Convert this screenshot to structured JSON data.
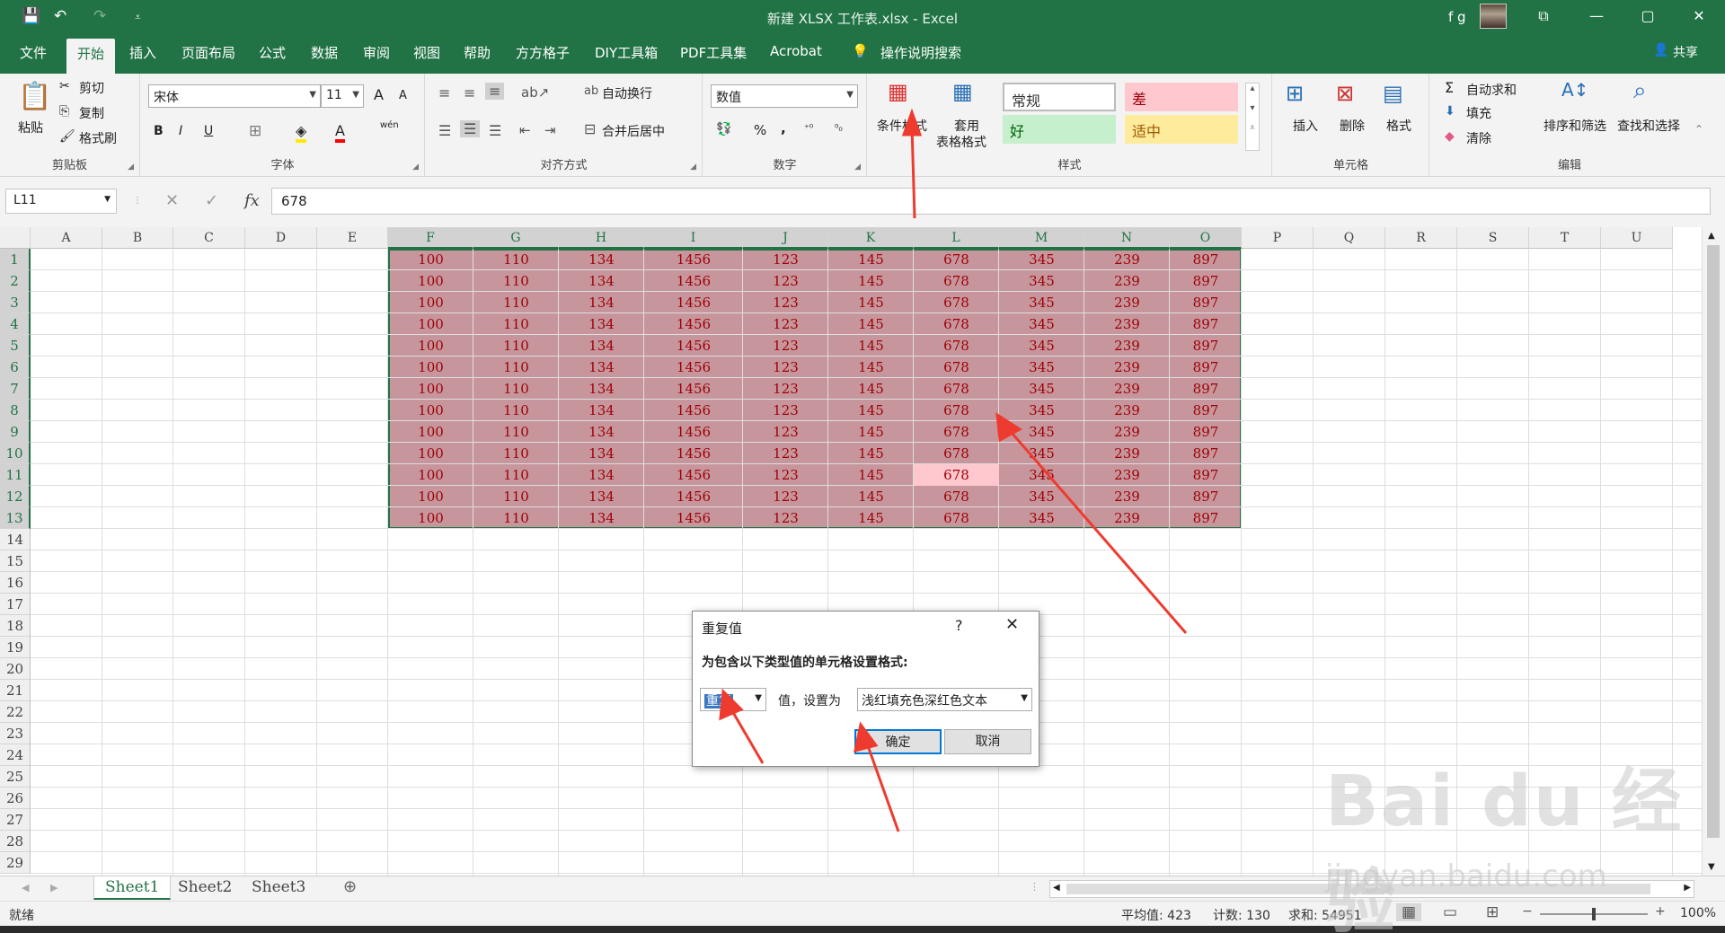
{
  "window": {
    "title": "新建 XLSX 工作表.xlsx  -  Excel",
    "user": "f g",
    "restore_icon": "⧉",
    "minimize": "—",
    "maximize": "▢",
    "close": "✕"
  },
  "quick_access": {
    "save": "💾",
    "undo": "↶",
    "redo": "↷",
    "customize": "⩡"
  },
  "tabs": [
    "文件",
    "开始",
    "插入",
    "页面布局",
    "公式",
    "数据",
    "审阅",
    "视图",
    "帮助",
    "方方格子",
    "DIY工具箱",
    "PDF工具集",
    "Acrobat"
  ],
  "active_tab": "开始",
  "tell_me": "操作说明搜索",
  "share": "共享",
  "ribbon": {
    "clipboard": {
      "paste": "粘贴",
      "cut": "剪切",
      "copy": "复制",
      "format_painter": "格式刷",
      "label": "剪贴板"
    },
    "font": {
      "name": "宋体",
      "size": "11",
      "grow": "A",
      "shrink": "A",
      "bold": "B",
      "italic": "I",
      "underline": "U",
      "label": "字体",
      "wen": "wén"
    },
    "alignment": {
      "wrap": "自动换行",
      "merge": "合并后居中",
      "label": "对齐方式"
    },
    "number": {
      "format": "数值",
      "percent": "%",
      "comma": ",",
      "label": "数字"
    },
    "styles": {
      "cond_format": "条件格式",
      "table_format_1": "套用",
      "table_format_2": "表格格式",
      "normal": "常规",
      "bad": "差",
      "good": "好",
      "neutral": "适中",
      "label": "样式"
    },
    "cells": {
      "insert": "插入",
      "delete": "删除",
      "format": "格式",
      "label": "单元格"
    },
    "editing": {
      "autosum": "自动求和",
      "fill": "填充",
      "clear": "清除",
      "sort": "排序和筛选",
      "find": "查找和选择",
      "label": "编辑"
    }
  },
  "formula_bar": {
    "name_box": "L11",
    "cancel": "✕",
    "enter": "✓",
    "fx": "fx",
    "value": "678"
  },
  "columns": [
    "A",
    "B",
    "C",
    "D",
    "E",
    "F",
    "G",
    "H",
    "I",
    "J",
    "K",
    "L",
    "M",
    "N",
    "O",
    "P",
    "Q",
    "R",
    "S",
    "T",
    "U"
  ],
  "rows": [
    "1",
    "2",
    "3",
    "4",
    "5",
    "6",
    "7",
    "8",
    "9",
    "10",
    "11",
    "12",
    "13",
    "14",
    "15",
    "16",
    "17",
    "18",
    "19",
    "20",
    "21",
    "22",
    "23",
    "24",
    "25",
    "26",
    "27",
    "28",
    "29"
  ],
  "data_row": [
    "100",
    "110",
    "134",
    "1456",
    "123",
    "145",
    "678",
    "345",
    "239",
    "897"
  ],
  "active_cell": "L11",
  "sheets": [
    "Sheet1",
    "Sheet2",
    "Sheet3"
  ],
  "active_sheet": "Sheet1",
  "status": {
    "ready": "就绪",
    "average": "平均值: 423",
    "count": "计数: 130",
    "sum": "求和: 54951",
    "zoom": "100%"
  },
  "dialog": {
    "title": "重复值",
    "help": "?",
    "close": "✕",
    "prompt": "为包含以下类型值的单元格设置格式:",
    "type_value": "重复",
    "mid_label": "值，设置为",
    "format_value": "浅红填充色深红色文本",
    "ok": "确定",
    "cancel": "取消"
  },
  "watermark": {
    "main": "Bai du 经验",
    "sub": "jingyan.baidu.com"
  },
  "colors": {
    "excel_green": "#217346",
    "selection_fill": "#c7969c",
    "active_cell_fill": "#ffc7ce",
    "dup_text": "#9c0006",
    "arrow": "#ee3b2f"
  }
}
